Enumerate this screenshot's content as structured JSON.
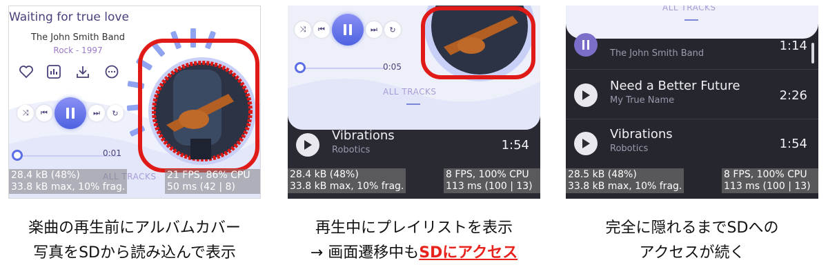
{
  "panels": [
    {
      "song_title": "Waiting for true love",
      "artist": "The John Smith Band",
      "genre_year": "Rock - 1997",
      "time": "0:01",
      "all_tracks": "ALL TRACKS",
      "stats_left": [
        "28.4 kB (48%)",
        "33.8 kB max, 10% frag."
      ],
      "stats_right": [
        "21 FPS, 86% CPU",
        "50 ms (42 | 8)"
      ]
    },
    {
      "time": "0:05",
      "all_tracks": "ALL TRACKS",
      "track": {
        "name": "Vibrations",
        "artist": "Robotics",
        "duration": "1:54"
      },
      "stats_left": [
        "28.4 kB (48%)",
        "33.8 kB max, 10% frag."
      ],
      "stats_right": [
        "8 FPS, 100% CPU",
        "113 ms (100 | 13)"
      ]
    },
    {
      "all_tracks": "ALL TRACKS",
      "tracks": [
        {
          "name": "",
          "artist": "The John Smith Band",
          "duration": "1:14"
        },
        {
          "name": "Need a Better Future",
          "artist": "My True Name",
          "duration": "2:26"
        },
        {
          "name": "Vibrations",
          "artist": "Robotics",
          "duration": "1:54"
        }
      ],
      "stats_left": [
        "28.5 kB (48%)",
        "33.8 kB max, 10% frag."
      ],
      "stats_right": [
        "8 FPS, 100% CPU",
        "113 ms (100 | 13)"
      ]
    }
  ],
  "captions": {
    "c1_line1": "楽曲の再生前にアルバムカバー",
    "c1_line2": "写真をSDから読み込んで表示",
    "c2_line1": "再生中にプレイリストを表示",
    "c2_line2_prefix": "→ 画面遷移中も",
    "c2_line2_highlight": "SDにアクセス",
    "c3_line1": "完全に隠れるまでSDへの",
    "c3_line2": "アクセスが続く"
  },
  "colors": {
    "accent": "#5c6ee6",
    "highlight": "#e8231e",
    "dark_bg": "#2a2a33"
  },
  "icons": [
    "heart-icon",
    "chart-icon",
    "download-icon",
    "chat-icon",
    "shuffle-icon",
    "prev-icon",
    "pause-icon",
    "next-icon",
    "repeat-icon",
    "play-icon"
  ]
}
